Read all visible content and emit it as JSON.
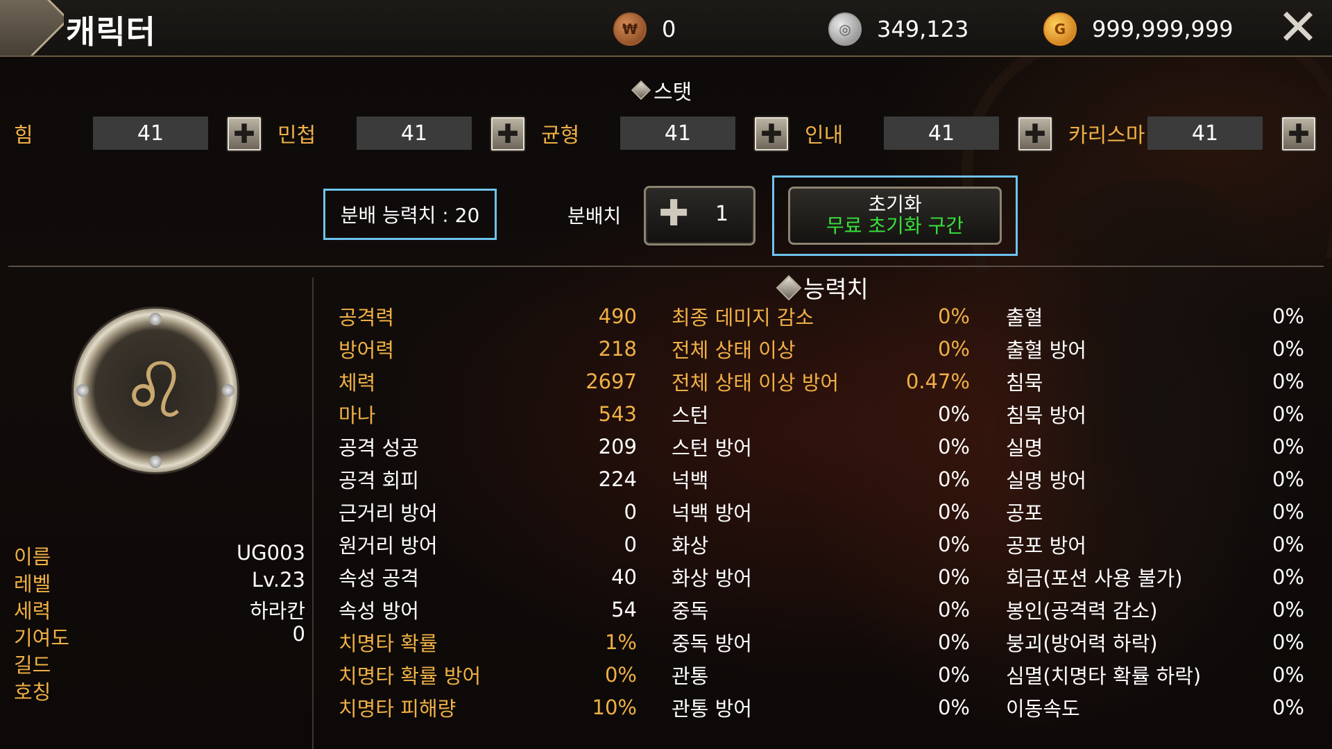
{
  "header": {
    "title": "캐릭터",
    "currencies": [
      {
        "icon": "bronze-coin-icon",
        "value": "0"
      },
      {
        "icon": "silver-coin-icon",
        "value": "349,123"
      },
      {
        "icon": "gold-coin-icon",
        "value": "999,999,999"
      }
    ],
    "close_glyph": "✕"
  },
  "stats": {
    "heading": "스탯",
    "items": [
      {
        "label": "힘",
        "value": "41"
      },
      {
        "label": "민첩",
        "value": "41"
      },
      {
        "label": "균형",
        "value": "41"
      },
      {
        "label": "인내",
        "value": "41"
      },
      {
        "label": "카리스마",
        "value": "41"
      }
    ],
    "distribute_points_label": "분배 능력치 : 20",
    "distribute_label": "분배치",
    "distribute_value": "1",
    "reset_label": "초기화",
    "reset_sub_label": "무료 초기화 구간"
  },
  "abilities": {
    "heading": "능력치",
    "col1": [
      {
        "name": "공격력",
        "value": "490",
        "hl": true
      },
      {
        "name": "방어력",
        "value": "218",
        "hl": true
      },
      {
        "name": "체력",
        "value": "2697",
        "hl": true
      },
      {
        "name": "마나",
        "value": "543",
        "hl": true
      },
      {
        "name": "공격 성공",
        "value": "209",
        "hl": false
      },
      {
        "name": "공격 회피",
        "value": "224",
        "hl": false
      },
      {
        "name": "근거리 방어",
        "value": "0",
        "hl": false
      },
      {
        "name": "원거리 방어",
        "value": "0",
        "hl": false
      },
      {
        "name": "속성 공격",
        "value": "40",
        "hl": false
      },
      {
        "name": "속성 방어",
        "value": "54",
        "hl": false
      },
      {
        "name": "치명타 확률",
        "value": "1%",
        "hl": true
      },
      {
        "name": "치명타 확률 방어",
        "value": "0%",
        "hl": true
      },
      {
        "name": "치명타 피해량",
        "value": "10%",
        "hl": true
      }
    ],
    "col2": [
      {
        "name": "최종 데미지 감소",
        "value": "0%",
        "hl": true
      },
      {
        "name": "전체 상태 이상",
        "value": "0%",
        "hl": true
      },
      {
        "name": "전체 상태 이상 방어",
        "value": "0.47%",
        "hl": true
      },
      {
        "name": "스턴",
        "value": "0%",
        "hl": false
      },
      {
        "name": "스턴 방어",
        "value": "0%",
        "hl": false
      },
      {
        "name": "넉백",
        "value": "0%",
        "hl": false
      },
      {
        "name": "넉백 방어",
        "value": "0%",
        "hl": false
      },
      {
        "name": "화상",
        "value": "0%",
        "hl": false
      },
      {
        "name": "화상 방어",
        "value": "0%",
        "hl": false
      },
      {
        "name": "중독",
        "value": "0%",
        "hl": false
      },
      {
        "name": "중독 방어",
        "value": "0%",
        "hl": false
      },
      {
        "name": "관통",
        "value": "0%",
        "hl": false
      },
      {
        "name": "관통 방어",
        "value": "0%",
        "hl": false
      }
    ],
    "col3": [
      {
        "name": "출혈",
        "value": "0%",
        "hl": false
      },
      {
        "name": "출혈 방어",
        "value": "0%",
        "hl": false
      },
      {
        "name": "침묵",
        "value": "0%",
        "hl": false
      },
      {
        "name": "침묵 방어",
        "value": "0%",
        "hl": false
      },
      {
        "name": "실명",
        "value": "0%",
        "hl": false
      },
      {
        "name": "실명 방어",
        "value": "0%",
        "hl": false
      },
      {
        "name": "공포",
        "value": "0%",
        "hl": false
      },
      {
        "name": "공포 방어",
        "value": "0%",
        "hl": false
      },
      {
        "name": "회금(포션 사용 불가)",
        "value": "0%",
        "hl": false
      },
      {
        "name": "봉인(공격력 감소)",
        "value": "0%",
        "hl": false
      },
      {
        "name": "붕괴(방어력 하락)",
        "value": "0%",
        "hl": false
      },
      {
        "name": "심멸(치명타 확률 하락)",
        "value": "0%",
        "hl": false
      },
      {
        "name": "이동속도",
        "value": "0%",
        "hl": false
      }
    ]
  },
  "profile": [
    {
      "key": "이름",
      "value": "UG003"
    },
    {
      "key": "레벨",
      "value": "Lv.23"
    },
    {
      "key": "세력",
      "value": "하라칸"
    },
    {
      "key": "기여도",
      "value": "0"
    },
    {
      "key": "길드",
      "value": ""
    },
    {
      "key": "호칭",
      "value": ""
    }
  ],
  "colors": {
    "accent": "#f0b045",
    "highlight_border": "#6ec4ef",
    "free_reset": "#37e03a"
  }
}
